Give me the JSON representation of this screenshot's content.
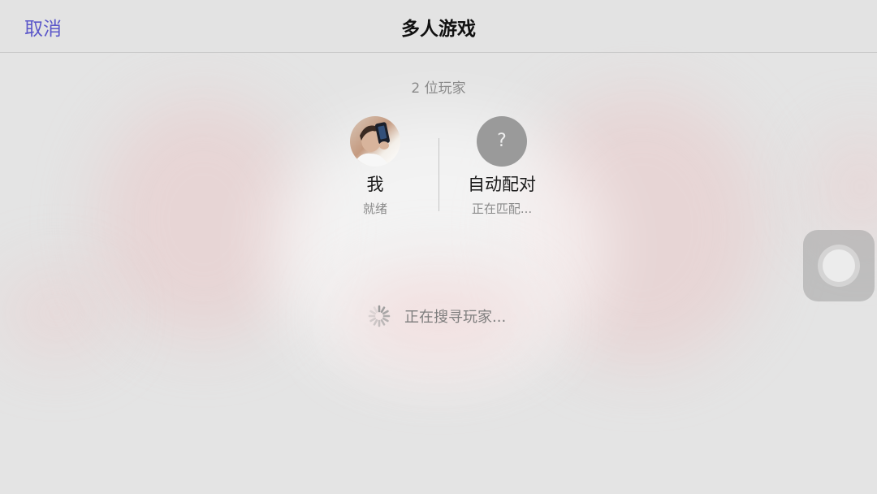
{
  "navbar": {
    "cancel_label": "取消",
    "title": "多人游戏"
  },
  "lobby": {
    "player_count": "2 位玩家",
    "players": [
      {
        "name": "我",
        "status": "就绪",
        "avatar": "user-photo"
      },
      {
        "name": "自动配对",
        "status": "正在匹配...",
        "avatar": "question-mark",
        "avatar_glyph": "?"
      }
    ],
    "searching_text": "正在搜寻玩家..."
  },
  "colors": {
    "accent": "#5b57c9",
    "background": "#e4e4e4",
    "unknown_avatar": "#9a9a9a"
  },
  "icons": {
    "loading": "spinner-icon",
    "assistive_touch": "assistive-touch-icon"
  }
}
